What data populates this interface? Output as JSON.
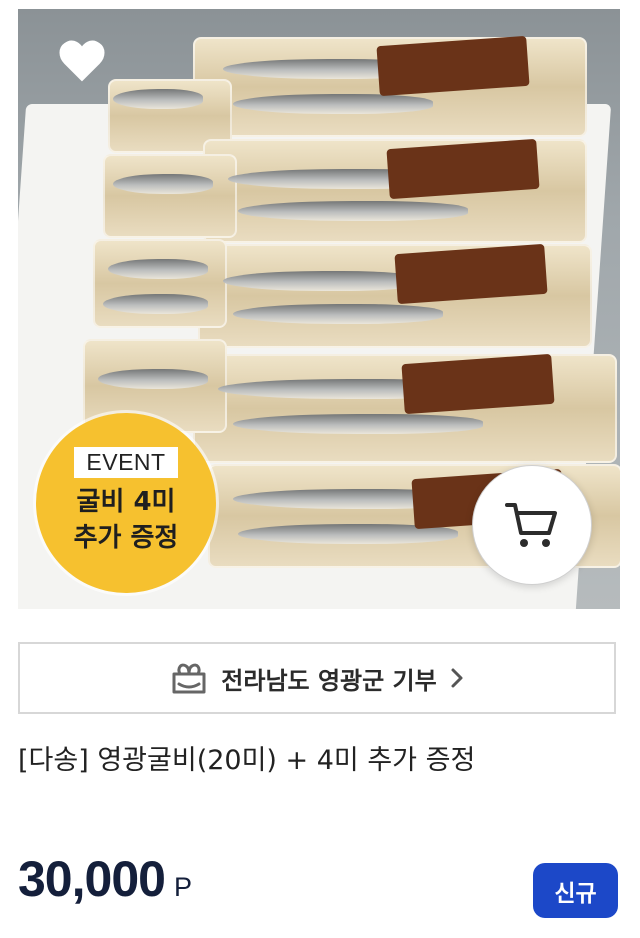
{
  "product": {
    "event_badge": {
      "tag": "EVENT",
      "line1": "굴비 4미",
      "line2": "추가 증정",
      "color": "#f6c12f"
    },
    "icons": {
      "wishlist": "heart-icon",
      "cart": "cart-icon",
      "donation": "gift-box-icon",
      "chevron": "chevron-right-icon"
    },
    "donation_label": "전라남도 영광군 기부",
    "title": "[다송] 영광굴비(20미) + 4미 추가 증정",
    "price": {
      "amount": "30,000",
      "unit": "P",
      "color": "#141f3b"
    },
    "status_badge": {
      "label": "신규",
      "color": "#1c48c8"
    }
  }
}
